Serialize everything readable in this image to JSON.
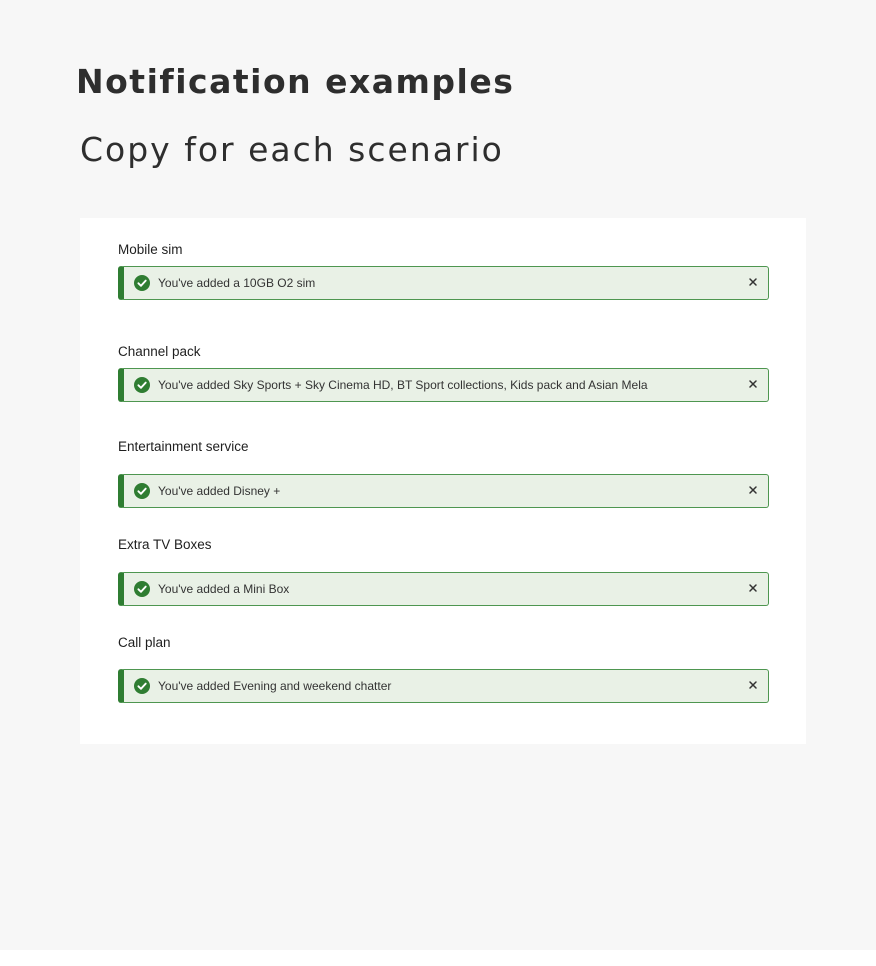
{
  "header": {
    "title": "Notification examples",
    "subtitle": "Copy for each scenario"
  },
  "icons": {
    "status_icon": "check-circle-icon",
    "dismiss_icon": "close-icon"
  },
  "colors": {
    "background": "#f7f7f7",
    "card": "#ffffff",
    "notification_fill": "#e9f1e6",
    "notification_border": "#4e9650",
    "accent_green": "#2f7d32",
    "text_dark": "#2e2e2e"
  },
  "sections": [
    {
      "label": "Mobile sim",
      "message": "You've added a 10GB O2 sim"
    },
    {
      "label": "Channel pack",
      "message": "You've added Sky Sports + Sky Cinema HD, BT Sport collections, Kids pack and Asian Mela"
    },
    {
      "label": "Entertainment service",
      "message": "You've added Disney +"
    },
    {
      "label": "Extra TV Boxes",
      "message": "You've added a Mini Box"
    },
    {
      "label": "Call plan",
      "message": "You've added Evening and weekend chatter"
    }
  ]
}
